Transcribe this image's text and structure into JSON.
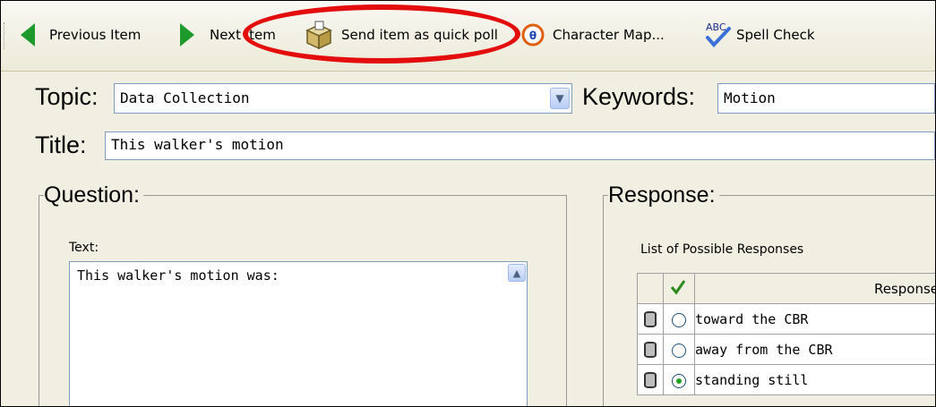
{
  "toolbar": {
    "previous_item": "Previous Item",
    "next_item": "Next Item",
    "send_quick_poll": "Send item as quick poll",
    "character_map": "Character Map...",
    "spell_check": "Spell Check",
    "abc_glyph": "ABC"
  },
  "form": {
    "topic_label": "Topic:",
    "topic_value": "Data Collection",
    "keywords_label": "Keywords:",
    "keywords_value": "Motion",
    "title_label": "Title:",
    "title_value": "This walker's motion"
  },
  "question": {
    "group_title": "Question:",
    "text_label": "Text:",
    "text_value": "This walker's motion was:"
  },
  "response": {
    "group_title": "Response:",
    "list_label": "List of Possible Responses",
    "column_header": "Response",
    "rows": [
      {
        "text": "toward the CBR",
        "selected": false
      },
      {
        "text": "away from the CBR",
        "selected": false
      },
      {
        "text": "standing still",
        "selected": true
      }
    ]
  },
  "colors": {
    "highlight_oval": "#e30d0d",
    "nav_arrow": "#1e9a2c",
    "check_mark": "#2a8a1a"
  },
  "icons": [
    "arrow-left-icon",
    "arrow-right-icon",
    "quick-poll-box-icon",
    "character-map-icon",
    "spell-check-icon",
    "dropdown-arrow-icon",
    "check-icon",
    "database-icon",
    "radio-icon"
  ]
}
